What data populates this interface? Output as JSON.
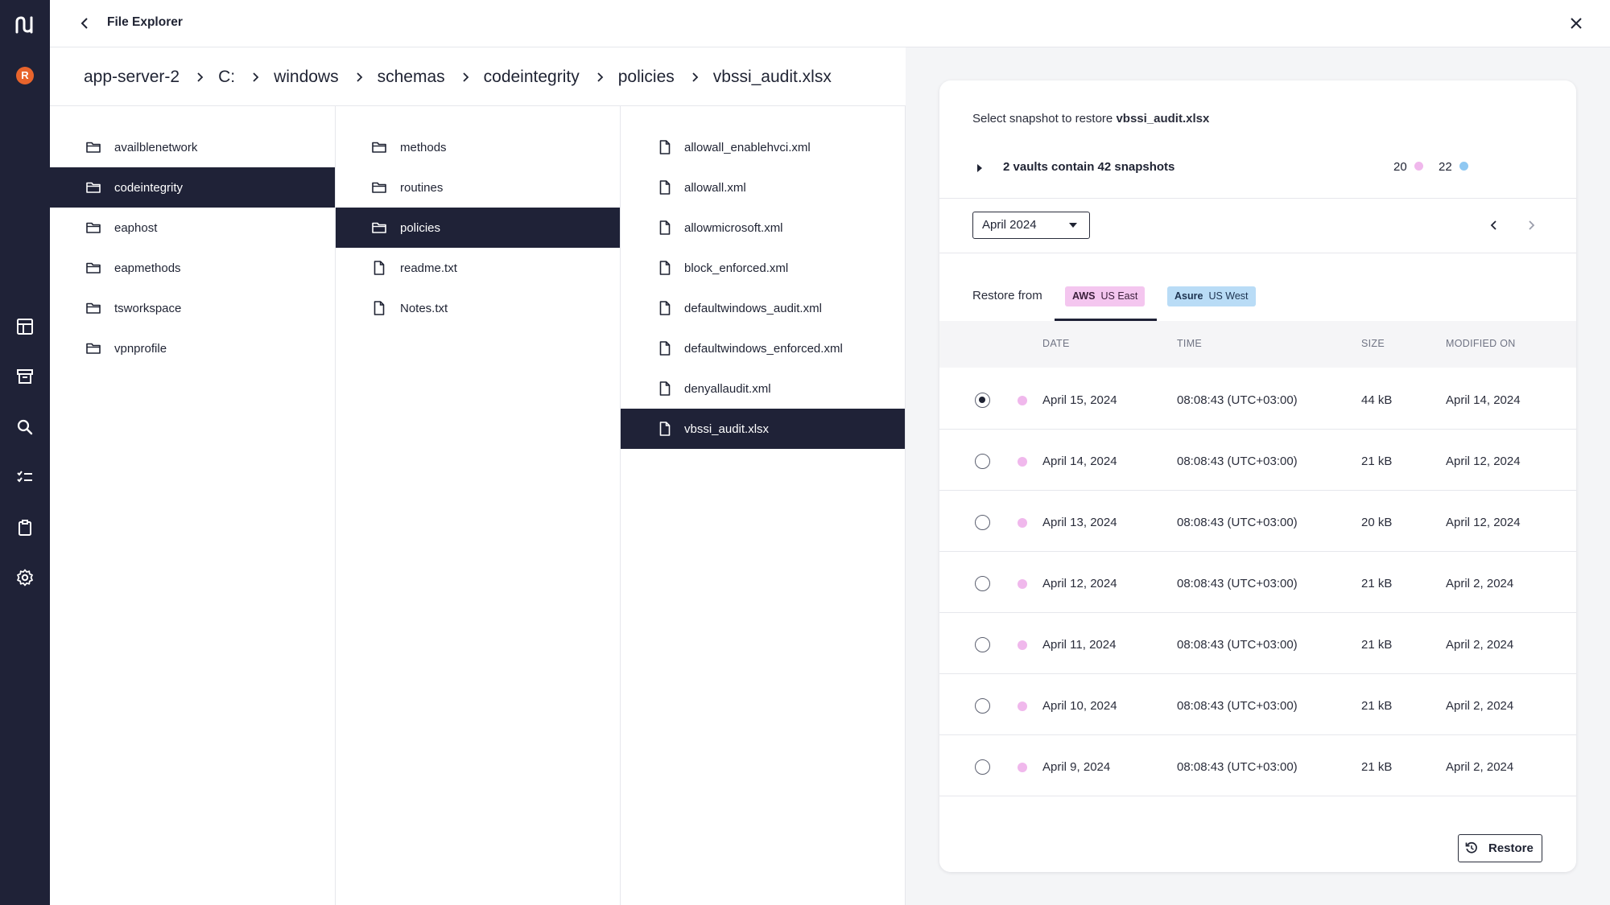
{
  "app": {
    "title": "File Explorer",
    "avatar_initial": "R"
  },
  "breadcrumb": [
    "app-server-2",
    "C:",
    "windows",
    "schemas",
    "codeintegrity",
    "policies",
    "vbssi_audit.xlsx"
  ],
  "column1": {
    "items": [
      "availblenetwork",
      "codeintegrity",
      "eaphost",
      "eapmethods",
      "tsworkspace",
      "vpnprofile"
    ],
    "selected": "codeintegrity"
  },
  "column2": {
    "folders": [
      "methods",
      "routines",
      "policies"
    ],
    "files": [
      "readme.txt",
      "Notes.txt"
    ],
    "selected": "policies"
  },
  "column3": {
    "files": [
      "allowall_enablehvci.xml",
      "allowall.xml",
      "allowmicrosoft.xml",
      "block_enforced.xml",
      "defaultwindows_audit.xml",
      "defaultwindows_enforced.xml",
      "denyallaudit.xml",
      "vbssi_audit.xlsx"
    ],
    "selected": "vbssi_audit.xlsx"
  },
  "panel": {
    "select_prefix": "Select snapshot to restore",
    "select_file": "vbssi_audit.xlsx",
    "vault_summary": "2 vaults contain 42 snapshots",
    "vault_counts": [
      {
        "count": "20",
        "color": "#f0b8ec"
      },
      {
        "count": "22",
        "color": "#8fc8f2"
      }
    ],
    "month": "April 2024",
    "restore_from_label": "Restore from",
    "tabs": [
      {
        "provider": "AWS",
        "region": "US East",
        "active": true
      },
      {
        "provider": "Asure",
        "region": "US West",
        "active": false
      }
    ],
    "columns": [
      "DATE",
      "TIME",
      "SIZE",
      "MODIFIED ON"
    ],
    "snapshots": [
      {
        "date": "April 15, 2024",
        "time": "08:08:43 (UTC+03:00)",
        "size": "44 kB",
        "modified": "April 14, 2024",
        "selected": true
      },
      {
        "date": "April 14, 2024",
        "time": "08:08:43 (UTC+03:00)",
        "size": "21 kB",
        "modified": "April 12, 2024",
        "selected": false
      },
      {
        "date": "April 13, 2024",
        "time": "08:08:43 (UTC+03:00)",
        "size": "20 kB",
        "modified": "April 12, 2024",
        "selected": false
      },
      {
        "date": "April 12, 2024",
        "time": "08:08:43 (UTC+03:00)",
        "size": "21 kB",
        "modified": "April 2, 2024",
        "selected": false
      },
      {
        "date": "April 11, 2024",
        "time": "08:08:43 (UTC+03:00)",
        "size": "21 kB",
        "modified": "April 2, 2024",
        "selected": false
      },
      {
        "date": "April 10, 2024",
        "time": "08:08:43 (UTC+03:00)",
        "size": "21 kB",
        "modified": "April 2, 2024",
        "selected": false
      },
      {
        "date": "April 9, 2024",
        "time": "08:08:43 (UTC+03:00)",
        "size": "21 kB",
        "modified": "April 2, 2024",
        "selected": false
      }
    ],
    "snapshot_dot_color": "#f0b8ec",
    "restore_label": "Restore"
  },
  "colors": {
    "rail": "#1f2237",
    "selected_row": "#1f2237",
    "avatar": "#e8642c",
    "aws_tab": "#f4c6ef",
    "azure_tab": "#b9dcf6"
  }
}
